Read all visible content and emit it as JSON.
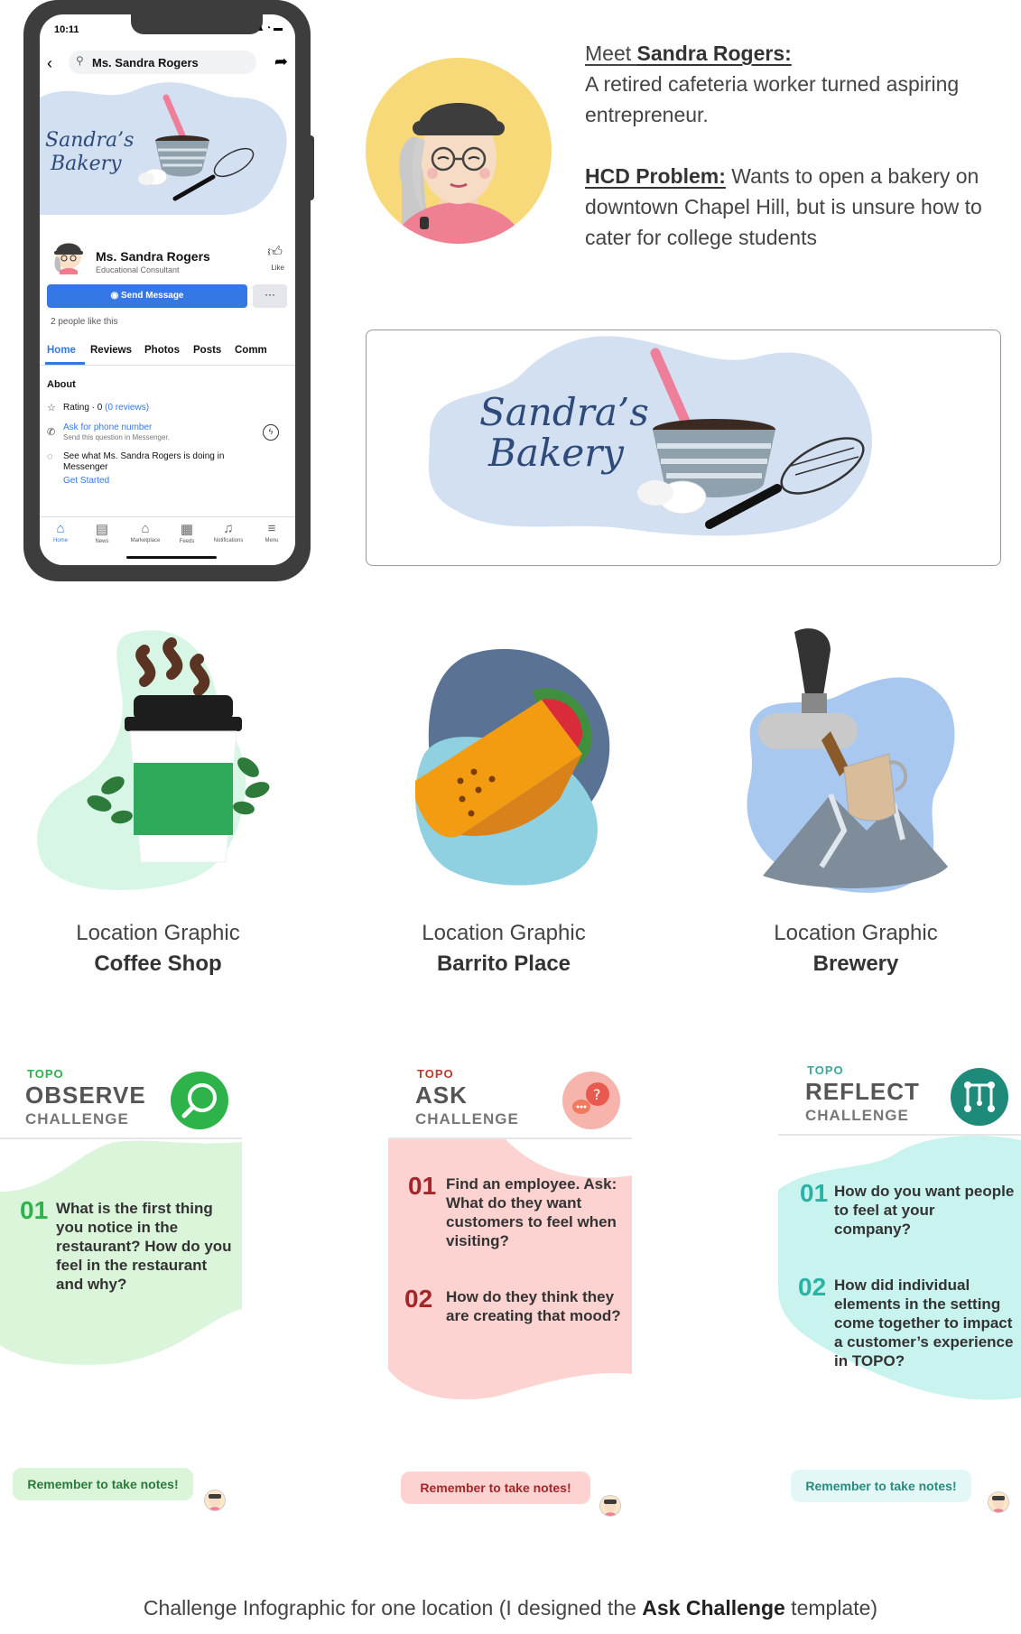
{
  "phone": {
    "time": "10:11",
    "status_icons": "▴ ◔ ▬",
    "search_text": "Ms. Sandra Rogers",
    "bakery_logo_line1": "Sandra’s",
    "bakery_logo_line2": "Bakery",
    "page_name": "Ms. Sandra Rogers",
    "page_category": "Educational Consultant",
    "like_label": "Like",
    "send_message_label": "Send Message",
    "more_label": "···",
    "likes_count": "2 people like this",
    "tabs": [
      "Home",
      "Reviews",
      "Photos",
      "Posts",
      "Comm"
    ],
    "about_heading": "About",
    "rating_prefix": "Rating · 0 ",
    "rating_link": "(0 reviews)",
    "ask_phone": "Ask for phone number",
    "ask_phone_sub": "Send this question in Messenger.",
    "see_what": "See what Ms. Sandra Rogers is doing in Messenger",
    "get_started": "Get Started",
    "bottom_nav": [
      "Home",
      "News",
      "Marketplace",
      "Feeds",
      "Notifications",
      "Menu"
    ]
  },
  "meet": {
    "meet_prefix": "Meet ",
    "meet_name": "Sandra Rogers:",
    "description": "A retired cafeteria worker turned aspiring entrepreneur.",
    "hcd_label": "HCD Problem:",
    "hcd_text": " Wants to open a bakery on downtown Chapel Hill, but is unsure how to cater for college students"
  },
  "logo_card": {
    "line1": "Sandra’s",
    "line2": "Bakery"
  },
  "locations": [
    {
      "label": "Location Graphic",
      "name": "Coffee Shop"
    },
    {
      "label": "Location Graphic",
      "name": "Barrito Place"
    },
    {
      "label": "Location Graphic",
      "name": "Brewery"
    }
  ],
  "challenges": {
    "observe": {
      "topo": "TOPO",
      "title": "OBSERVE",
      "sub": "CHALLENGE",
      "q1_num": "01",
      "q1": "What is the first thing you notice in the restaurant? How do you feel in the restaurant and why?",
      "notes": "Remember to take notes!"
    },
    "ask": {
      "topo": "TOPO",
      "title": "ASK",
      "sub": "CHALLENGE",
      "q1_num": "01",
      "q1": "Find an employee. Ask: What do they want customers to feel when visiting?",
      "q2_num": "02",
      "q2": "How do they think they are creating that mood?",
      "notes": "Remember to take notes!"
    },
    "reflect": {
      "topo": "TOPO",
      "title": "REFLECT",
      "sub": "CHALLENGE",
      "q1_num": "01",
      "q1": "How do you want people to feel at your company?",
      "q2_num": "02",
      "q2": "How did individual elements in the setting come together to impact a customer’s experience in TOPO?",
      "notes": "Remember to take notes!"
    }
  },
  "caption": {
    "prefix": "Challenge Infographic for one location (I designed the ",
    "bold": "Ask Challenge",
    "suffix": " template)"
  },
  "colors": {
    "fb_blue": "#3578e5",
    "observe_green": "#2db34a",
    "ask_red": "#c0392b",
    "reflect_teal": "#1e8a7a",
    "bakery_blue": "#d3e0f2"
  }
}
